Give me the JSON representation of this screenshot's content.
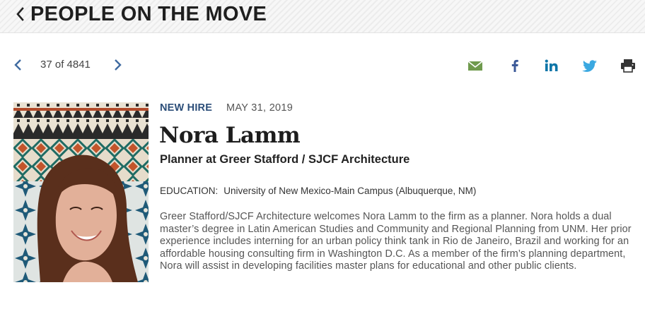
{
  "header": {
    "back_icon": "chevron-left-icon",
    "title": "PEOPLE ON THE MOVE"
  },
  "pager": {
    "prev_icon": "chevron-left-icon",
    "count": "37 of 4841",
    "next_icon": "chevron-right-icon"
  },
  "share": [
    {
      "icon": "email-icon",
      "color": "#6f9a4d"
    },
    {
      "icon": "facebook-icon",
      "color": "#3b5998"
    },
    {
      "icon": "linkedin-icon",
      "color": "#0e76a8"
    },
    {
      "icon": "twitter-icon",
      "color": "#3aa8e1"
    },
    {
      "icon": "print-icon",
      "color": "#333333"
    }
  ],
  "article": {
    "category": "NEW HIRE",
    "date": "MAY 31, 2019",
    "name": "Nora Lamm",
    "role": "Planner at Greer Stafford / SJCF Architecture",
    "education_label": "EDUCATION:",
    "education_value": "University of New Mexico-Main Campus (Albuquerque, NM)",
    "bio": "Greer Stafford/SJCF Architecture welcomes Nora Lamm to the firm as a planner. Nora holds a dual master’s degree in Latin American Studies and Community and Regional Planning from UNM. Her prior experience includes interning for an urban policy think tank in Rio de Janeiro, Brazil and working for an affordable housing consulting firm in Washington D.C. As a member of the firm’s planning department, Nora will assist in developing facilities master plans for educational and other public clients."
  },
  "colors": {
    "category": "#2c4e79",
    "pager_arrow": "#3f6aa0"
  }
}
